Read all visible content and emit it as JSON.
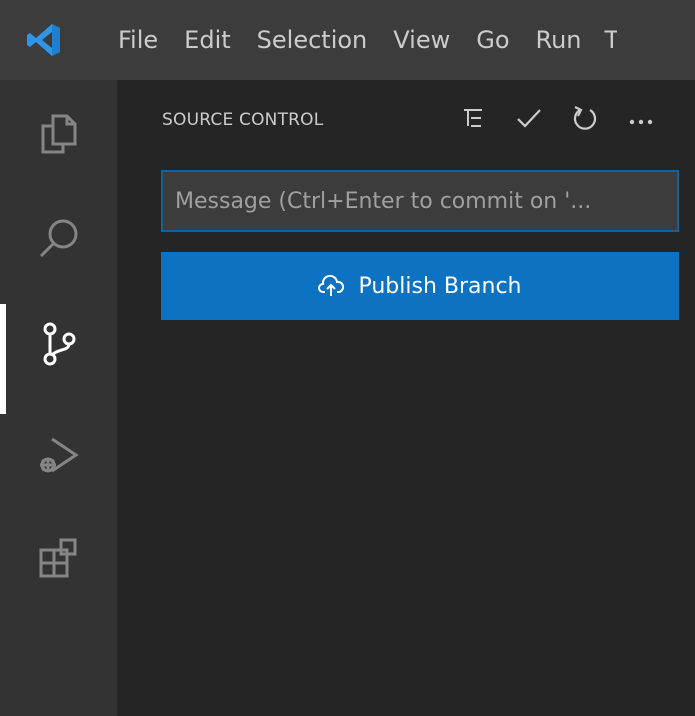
{
  "menu": {
    "items": [
      "File",
      "Edit",
      "Selection",
      "View",
      "Go",
      "Run",
      "T"
    ]
  },
  "activity_bar": {
    "items": [
      {
        "icon": "files-icon"
      },
      {
        "icon": "search-icon"
      },
      {
        "icon": "source-control-icon",
        "active": true
      },
      {
        "icon": "run-debug-icon"
      },
      {
        "icon": "extensions-icon"
      }
    ]
  },
  "sidebar": {
    "title": "SOURCE CONTROL",
    "actions": [
      "view-as-tree-icon",
      "commit-check-icon",
      "refresh-icon",
      "more-actions-icon"
    ],
    "commit_input": {
      "placeholder": "Message (Ctrl+Enter to commit on '...",
      "value": ""
    },
    "publish_button": {
      "label": "Publish Branch",
      "icon": "cloud-upload-icon"
    }
  },
  "colors": {
    "titlebar": "#3c3c3c",
    "activity_bar": "#333333",
    "sidebar": "#252526",
    "accent_blue": "#0e72c3",
    "input_border": "#0e639c",
    "logo_blue": "#2f96e6"
  }
}
